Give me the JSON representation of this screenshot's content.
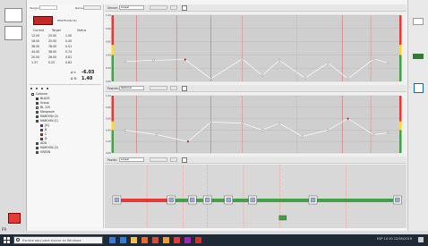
{
  "panel": {
    "header_left_label": "Tangent",
    "header_left_value": "",
    "header_right_label": "Name",
    "swatch_label": "HEATFLOW (6)",
    "col_headers": [
      "Current",
      "Target",
      "Status"
    ],
    "rows": [
      [
        "12.00",
        "25.00",
        "1.00"
      ],
      [
        "18.00",
        "25.00",
        "0.40"
      ],
      [
        "38.00",
        "78.00",
        "0.51"
      ],
      [
        "44.00",
        "38.00",
        "0.74"
      ],
      [
        "20.00",
        "26.00",
        "0.81"
      ],
      [
        "1.37",
        "5.25",
        "0.63"
      ]
    ],
    "big1": "-6.03",
    "big2": "1.40",
    "big1_label": "Δ t:",
    "big2_label": "Δ R:",
    "tree": [
      {
        "label": "Colonne",
        "color": "#ffffff"
      },
      {
        "label": "BLACK",
        "color": "#111111"
      },
      {
        "label": "Group",
        "color": "#1565c0"
      },
      {
        "label": "BL 125",
        "color": "#ffffff"
      },
      {
        "label": "Mangrove",
        "color": "#c62828"
      },
      {
        "label": "MAROON (2)",
        "color": "#c62828"
      },
      {
        "label": "MAROON (1)",
        "color": "#c62828"
      },
      {
        "label": "[A]",
        "color": "#6a1b9a"
      },
      {
        "label": "B",
        "color": "#c62828"
      },
      {
        "label": "C",
        "color": "#c62828"
      },
      {
        "label": "D",
        "color": "#c62828"
      },
      {
        "label": "ADD",
        "color": "#2e7d32"
      },
      {
        "label": "MAROON (2)",
        "color": "#2e7d32"
      },
      {
        "label": "GREEN",
        "color": "#2e7d32"
      }
    ]
  },
  "toolbars": [
    {
      "label": "Sensor:",
      "value": "Lineal"
    },
    {
      "label": "Posicón:",
      "value": "Optimal"
    },
    {
      "label": "Poción:",
      "value": "Lineal"
    }
  ],
  "chart1": {
    "type": "line",
    "points": [
      [
        0.04,
        0.28
      ],
      [
        0.14,
        0.3
      ],
      [
        0.25,
        0.31
      ],
      [
        0.34,
        0.02
      ],
      [
        0.45,
        0.32
      ],
      [
        0.52,
        0.07
      ],
      [
        0.58,
        0.3
      ],
      [
        0.67,
        0.03
      ],
      [
        0.75,
        0.26
      ],
      [
        0.82,
        0.02
      ],
      [
        0.91,
        0.32
      ],
      [
        0.96,
        0.26
      ]
    ],
    "marker_colors": [
      "#ffffff",
      "#ffffff",
      "#c62828",
      "#ffffff",
      "#ffffff",
      "#ffffff",
      "#ffffff",
      "#ffffff",
      "#ffffff",
      "#ffffff",
      "#ffffff",
      "#ffffff"
    ],
    "y_ticks": [
      "1.00",
      "0.80",
      "0.60",
      "0.40",
      "0.20",
      "0.00"
    ],
    "band_colors": [
      "#e53935",
      "#fdd835",
      "#43a047"
    ]
  },
  "chart2": {
    "type": "line",
    "points": [
      [
        0.04,
        0.38
      ],
      [
        0.15,
        0.3
      ],
      [
        0.26,
        0.18
      ],
      [
        0.34,
        0.52
      ],
      [
        0.45,
        0.5
      ],
      [
        0.52,
        0.38
      ],
      [
        0.58,
        0.5
      ],
      [
        0.66,
        0.27
      ],
      [
        0.75,
        0.38
      ],
      [
        0.82,
        0.58
      ],
      [
        0.91,
        0.3
      ],
      [
        0.96,
        0.33
      ]
    ],
    "marker_colors": [
      "#ffffff",
      "#ffffff",
      "#c62828",
      "#ffffff",
      "#ffffff",
      "#ffffff",
      "#ffffff",
      "#ffffff",
      "#ffffff",
      "#c62828",
      "#ffffff",
      "#ffffff"
    ],
    "y_ticks": [
      "1.00",
      "0.80",
      "0.60",
      "0.40",
      "0.20",
      "0.00"
    ],
    "band_colors": [
      "#e53935",
      "#fdd835",
      "#43a047"
    ]
  },
  "timeline": {
    "nodes": [
      {
        "x": 0.04,
        "color": "#e53935"
      },
      {
        "x": 0.22,
        "color": "#e53935"
      },
      {
        "x": 0.29,
        "color": "#43a047"
      },
      {
        "x": 0.34,
        "color": "#43a047"
      },
      {
        "x": 0.41,
        "color": "#43a047"
      },
      {
        "x": 0.49,
        "color": "#43a047"
      },
      {
        "x": 0.69,
        "color": "#43a047"
      },
      {
        "x": 0.97,
        "color": "#43a047"
      }
    ],
    "marker_bottom": {
      "x": 0.59
    }
  },
  "taskbar": {
    "search_placeholder": "Escribe aquí para buscar en Windows",
    "tray_time": "10:30",
    "tray_date": "12/05/2019",
    "tray_text": "ESP 10:30  12/05/2019"
  },
  "footer": {
    "fn_label": "F9"
  }
}
